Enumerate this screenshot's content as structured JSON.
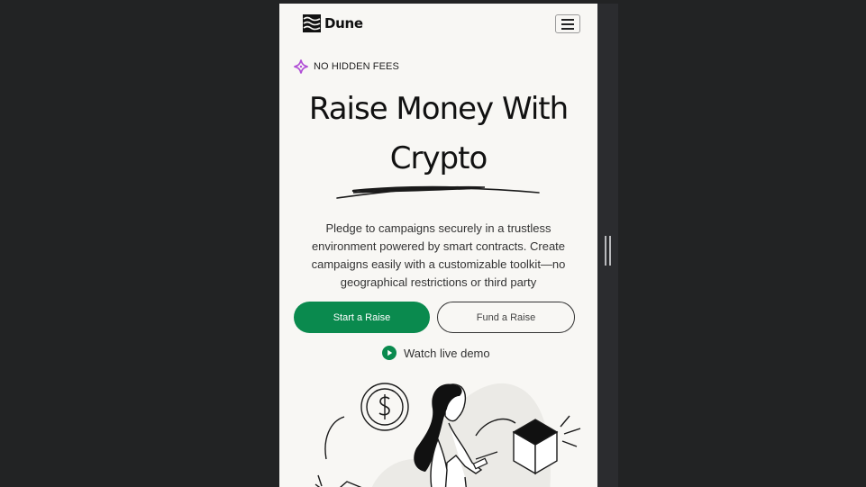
{
  "app": {
    "brand_name": "Dune",
    "menu_icon": "hamburger-menu-icon"
  },
  "hero": {
    "badge_text": "NO HIDDEN FEES",
    "badge_icon": "sparkle-icon",
    "title_line1": "Raise Money With",
    "title_line2": "Crypto",
    "description": "Pledge to campaigns securely in a trustless environment powered by smart contracts. Create campaigns easily with a customizable toolkit—no geographical restrictions or third party"
  },
  "actions": {
    "primary_label": "Start a Raise",
    "secondary_label": "Fund a Raise",
    "demo_label": "Watch live demo",
    "demo_icon": "play-circle-icon"
  },
  "colors": {
    "accent_green": "#0a8a4e",
    "badge_purple": "#b04fd6",
    "page_bg": "#f8f7f4",
    "outer_bg": "#222324"
  }
}
